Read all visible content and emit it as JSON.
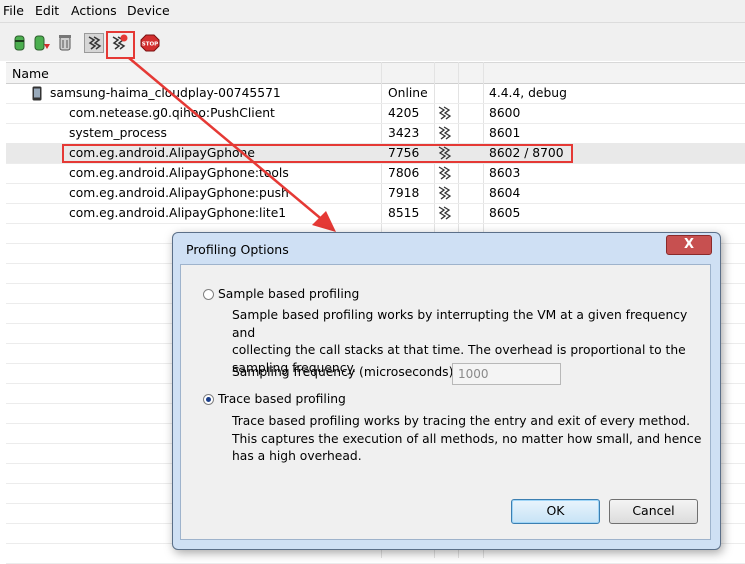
{
  "menu": [
    "File",
    "Edit",
    "Actions",
    "Device"
  ],
  "toolbar": {
    "icons": [
      "update-heap-icon",
      "dump-hprof-icon",
      "gc-icon",
      "update-threads-icon",
      "start-method-profiling-icon",
      "stop-process-icon"
    ],
    "stop_label": "STOP"
  },
  "table": {
    "header": "Name",
    "rows": [
      {
        "name": "samsung-haima_cloudplay-00745571",
        "pid": "Online",
        "port": "4.4.4, debug",
        "device": true,
        "traced": false,
        "selected": false
      },
      {
        "name": "com.netease.g0.qihoo:PushClient",
        "pid": "4205",
        "port": "8600",
        "device": false,
        "traced": true,
        "selected": false
      },
      {
        "name": "system_process",
        "pid": "3423",
        "port": "8601",
        "device": false,
        "traced": true,
        "selected": false
      },
      {
        "name": "com.eg.android.AlipayGphone",
        "pid": "7756",
        "port": "8602 / 8700",
        "device": false,
        "traced": true,
        "selected": true
      },
      {
        "name": "com.eg.android.AlipayGphone:tools",
        "pid": "7806",
        "port": "8603",
        "device": false,
        "traced": true,
        "selected": false
      },
      {
        "name": "com.eg.android.AlipayGphone:push",
        "pid": "7918",
        "port": "8604",
        "device": false,
        "traced": true,
        "selected": false
      },
      {
        "name": "com.eg.android.AlipayGphone:lite1",
        "pid": "8515",
        "port": "8605",
        "device": false,
        "traced": true,
        "selected": false
      }
    ]
  },
  "dialog": {
    "title": "Profiling Options",
    "close": "X",
    "sample_label": "Sample based profiling",
    "sample_selected": false,
    "sample_desc": [
      "Sample based profiling works by interrupting the VM at a given frequency and",
      "collecting the call stacks at that time. The overhead is proportional to the",
      "sampling frequency."
    ],
    "freq_label": "Sampling frequency (microseconds):",
    "freq_value": "1000",
    "trace_label": "Trace based profiling",
    "trace_selected": true,
    "trace_desc": [
      "Trace based profiling works by tracing the entry and exit of every method.",
      "This captures the execution of all methods, no matter how small, and hence",
      "has a high overhead."
    ],
    "ok": "OK",
    "cancel": "Cancel"
  },
  "colors": {
    "highlight": "#e53935",
    "dialog_frame": "#cfe0f4"
  }
}
